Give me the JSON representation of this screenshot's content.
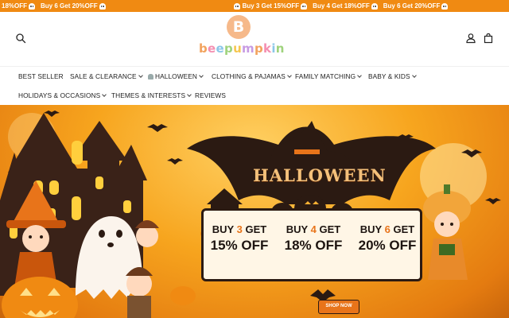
{
  "promo": {
    "items": [
      "18%OFF",
      "Buy 6 Get 20%OFF",
      "Buy 3 Get 15%OFF",
      "Buy 4 Get 18%OFF",
      "Buy 6 Get 20%OFF"
    ],
    "leading_fragment": "18%OFF",
    "second": "Buy 6 Get 20%OFF",
    "third": "Buy 3 Get 15%OFF",
    "fourth": "Buy 4 Get 18%OFF",
    "fifth": "Buy 6 Get 20%OFF",
    "bar_color": "#f08a12"
  },
  "header": {
    "logo_text": "beepumpkin",
    "logo_letters": [
      "b",
      "e",
      "e",
      "p",
      "u",
      "m",
      "p",
      "k",
      "i",
      "n"
    ],
    "icons": {
      "search": "search-icon",
      "account": "user-icon",
      "cart": "shopping-bag-icon"
    }
  },
  "nav": {
    "row1": [
      {
        "label": "BEST SELLER",
        "dropdown": false
      },
      {
        "label": "SALE & CLEARANCE",
        "dropdown": true
      },
      {
        "label": "HALLOWEEN",
        "dropdown": true,
        "icon": "ghost-icon"
      },
      {
        "label": "CLOTHING & PAJAMAS",
        "dropdown": true
      },
      {
        "label": "FAMILY MATCHING",
        "dropdown": true
      },
      {
        "label": "BABY & KIDS",
        "dropdown": true
      }
    ],
    "row2": [
      {
        "label": "HOLIDAYS & OCCASIONS",
        "dropdown": true
      },
      {
        "label": "THEMES & INTERESTS",
        "dropdown": true
      },
      {
        "label": "REVIEWS",
        "dropdown": false
      }
    ]
  },
  "hero": {
    "title": "HALLOWEEN",
    "offers": [
      {
        "buy": "BUY",
        "qty": "3",
        "get": "GET",
        "pct": "15%",
        "off": "OFF"
      },
      {
        "buy": "BUY",
        "qty": "4",
        "get": "GET",
        "pct": "18%",
        "off": "OFF"
      },
      {
        "buy": "BUY",
        "qty": "6",
        "get": "GET",
        "pct": "20%",
        "off": "OFF"
      }
    ],
    "cta": "SHOP NOW",
    "accent_color": "#e8741a"
  }
}
